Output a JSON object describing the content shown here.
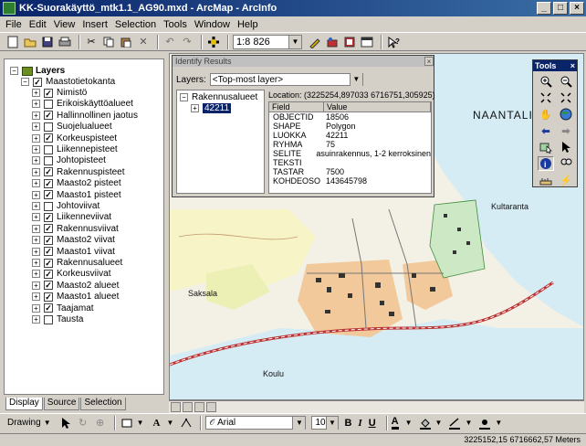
{
  "window": {
    "title": "KK-Suorakäyttö_mtk1.1_AG90.mxd - ArcMap - ArcInfo"
  },
  "menu": [
    "File",
    "Edit",
    "View",
    "Insert",
    "Selection",
    "Tools",
    "Window",
    "Help"
  ],
  "toolbar": {
    "scale": "1:8 826"
  },
  "toc": {
    "root": "Layers",
    "group": "Maastotietokanta",
    "layers": [
      {
        "name": "Nimistö",
        "expandable": true,
        "checked": true
      },
      {
        "name": "Erikoiskäyttöalueet",
        "expandable": true,
        "checked": false
      },
      {
        "name": "Hallinnollinen jaotus",
        "expandable": true,
        "checked": true
      },
      {
        "name": "Suojelualueet",
        "expandable": true,
        "checked": false
      },
      {
        "name": "Korkeuspisteet",
        "expandable": true,
        "checked": true
      },
      {
        "name": "Liikennepisteet",
        "expandable": true,
        "checked": false
      },
      {
        "name": "Johtopisteet",
        "expandable": true,
        "checked": false
      },
      {
        "name": "Rakennuspisteet",
        "expandable": true,
        "checked": true
      },
      {
        "name": "Maasto2 pisteet",
        "expandable": true,
        "checked": true
      },
      {
        "name": "Maasto1 pisteet",
        "expandable": true,
        "checked": true
      },
      {
        "name": "Johtoviivat",
        "expandable": true,
        "checked": false
      },
      {
        "name": "Liikenneviivat",
        "expandable": true,
        "checked": true
      },
      {
        "name": "Rakennusviivat",
        "expandable": true,
        "checked": true
      },
      {
        "name": "Maasto2 viivat",
        "expandable": true,
        "checked": true
      },
      {
        "name": "Maasto1 viivat",
        "expandable": true,
        "checked": true
      },
      {
        "name": "Rakennusalueet",
        "expandable": true,
        "checked": true
      },
      {
        "name": "Korkeusviivat",
        "expandable": true,
        "checked": true
      },
      {
        "name": "Maasto2 alueet",
        "expandable": true,
        "checked": true
      },
      {
        "name": "Maasto1 alueet",
        "expandable": true,
        "checked": true
      },
      {
        "name": "Taajamat",
        "expandable": true,
        "checked": true
      },
      {
        "name": "Tausta",
        "expandable": true,
        "checked": false
      }
    ],
    "tabs": [
      "Display",
      "Source",
      "Selection"
    ]
  },
  "identify": {
    "title": "Identify Results",
    "layers_label": "Layers:",
    "layers_value": "<Top-most layer>",
    "tree_parent": "Rakennusalueet",
    "tree_child": "42211",
    "location": "Location: (3225254,897033 6716751,305925)",
    "columns": [
      "Field",
      "Value"
    ],
    "rows": [
      {
        "field": "OBJECTID",
        "value": "18506"
      },
      {
        "field": "SHAPE",
        "value": "Polygon"
      },
      {
        "field": "LUOKKA",
        "value": "42211"
      },
      {
        "field": "RYHMA",
        "value": "75"
      },
      {
        "field": "SELITE",
        "value": "asuinrakennus, 1-2 kerroksinen"
      },
      {
        "field": "TEKSTI",
        "value": ""
      },
      {
        "field": "TASTAR",
        "value": "7500"
      },
      {
        "field": "KOHDEOSO",
        "value": "143645798"
      }
    ]
  },
  "tools_palette": {
    "title": "Tools"
  },
  "map_labels": {
    "naantali": "NAANTALI",
    "kultaranta": "Kultaranta",
    "saksala": "Saksala",
    "koulu": "Koulu"
  },
  "drawing": {
    "drawing_label": "Drawing",
    "font": "Arial",
    "font_size": "10",
    "bold": "B",
    "italic": "I",
    "underline": "U",
    "font_color": "A"
  },
  "status": {
    "coords": "3225152,15  6716662,57 Meters"
  }
}
